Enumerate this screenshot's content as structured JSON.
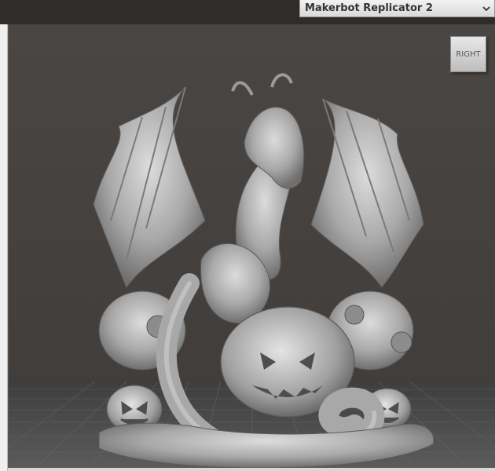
{
  "toolbar": {
    "printer_label": "Makerbot Replicator 2"
  },
  "viewport": {
    "view_cube_label": "RIGHT"
  },
  "icons": {
    "dropdown": "chevron-down-icon"
  },
  "colors": {
    "background": "#3a3735",
    "model": "#b8b8b8",
    "build_plate": "#4c4c4c"
  }
}
